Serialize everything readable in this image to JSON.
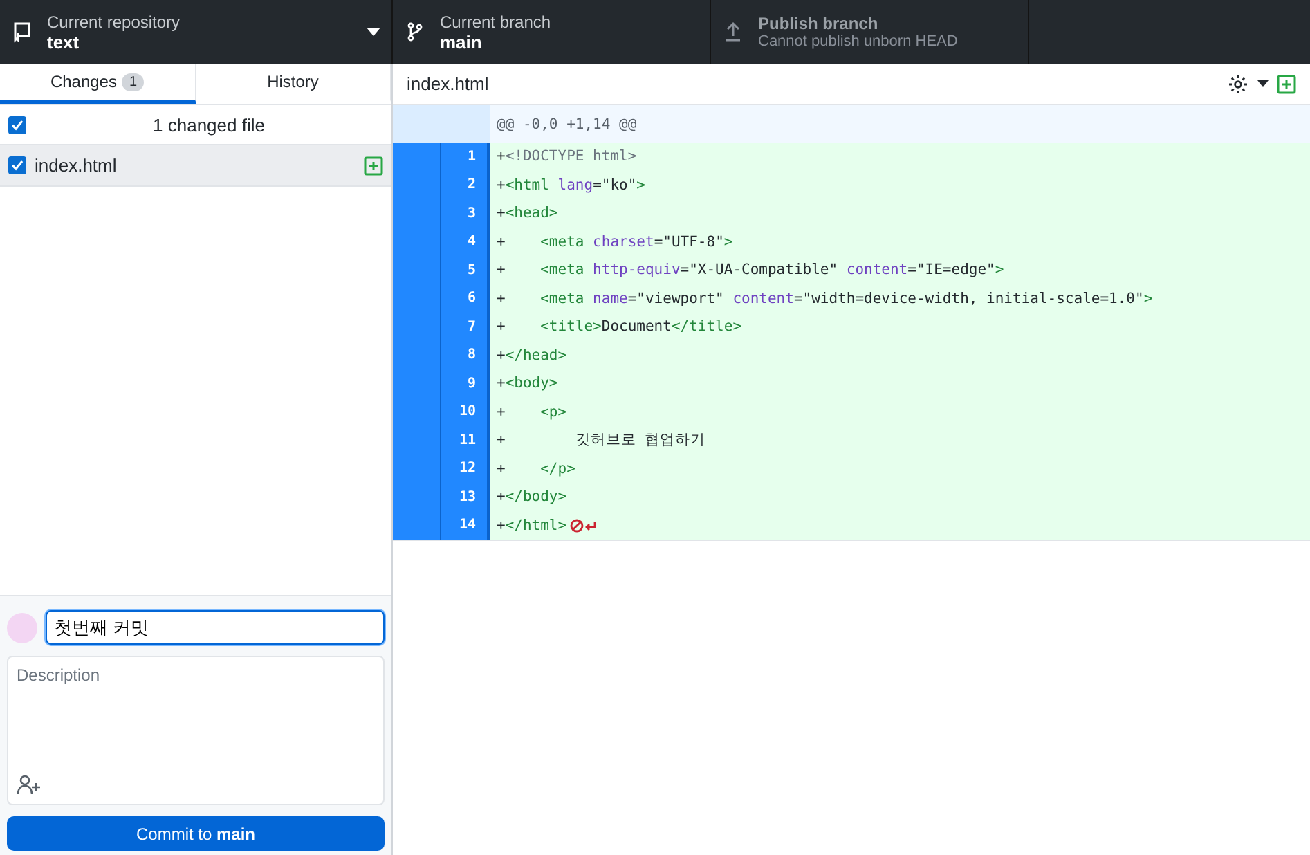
{
  "toolbar": [
    {
      "kind": "repository",
      "label": "Current repository",
      "value": "text",
      "disabled": false
    },
    {
      "kind": "branch",
      "label": "Current branch",
      "value": "main",
      "disabled": false
    },
    {
      "kind": "publish",
      "label": "Publish branch",
      "value": "Cannot publish unborn HEAD",
      "disabled": true
    }
  ],
  "tabs": [
    {
      "label": "Changes",
      "count": "1",
      "selected": true
    },
    {
      "label": "History",
      "selected": false
    }
  ],
  "changes_header": {
    "label": "1 changed file",
    "checked": true
  },
  "files": [
    {
      "name": "index.html",
      "checked": true,
      "selected": true,
      "kind": "added"
    }
  ],
  "diff": {
    "path": "index.html",
    "hunk": "@@ -0,0 +1,14 @@",
    "lines": [
      {
        "number": "1",
        "segments": [
          {
            "kind": "plain",
            "text": "+"
          },
          {
            "kind": "doctype",
            "text": "<!DOCTYPE html>"
          }
        ]
      },
      {
        "number": "2",
        "segments": [
          {
            "kind": "plain",
            "text": "+"
          },
          {
            "kind": "tag",
            "text": "<html "
          },
          {
            "kind": "attr",
            "text": "lang"
          },
          {
            "kind": "plain",
            "text": "=\"ko\""
          },
          {
            "kind": "tag",
            "text": ">"
          }
        ]
      },
      {
        "number": "3",
        "segments": [
          {
            "kind": "plain",
            "text": "+"
          },
          {
            "kind": "tag",
            "text": "<head>"
          }
        ]
      },
      {
        "number": "4",
        "segments": [
          {
            "kind": "plain",
            "text": "+    "
          },
          {
            "kind": "tag",
            "text": "<meta "
          },
          {
            "kind": "attr",
            "text": "charset"
          },
          {
            "kind": "plain",
            "text": "=\"UTF-8\""
          },
          {
            "kind": "tag",
            "text": ">"
          }
        ]
      },
      {
        "number": "5",
        "segments": [
          {
            "kind": "plain",
            "text": "+    "
          },
          {
            "kind": "tag",
            "text": "<meta "
          },
          {
            "kind": "attr",
            "text": "http-equiv"
          },
          {
            "kind": "plain",
            "text": "=\"X-UA-Compatible\" "
          },
          {
            "kind": "attr",
            "text": "content"
          },
          {
            "kind": "plain",
            "text": "=\"IE=edge\""
          },
          {
            "kind": "tag",
            "text": ">"
          }
        ]
      },
      {
        "number": "6",
        "segments": [
          {
            "kind": "plain",
            "text": "+    "
          },
          {
            "kind": "tag",
            "text": "<meta "
          },
          {
            "kind": "attr",
            "text": "name"
          },
          {
            "kind": "plain",
            "text": "=\"viewport\" "
          },
          {
            "kind": "attr",
            "text": "content"
          },
          {
            "kind": "plain",
            "text": "=\"width=device-width, initial-scale=1.0\""
          },
          {
            "kind": "tag",
            "text": ">"
          }
        ]
      },
      {
        "number": "7",
        "segments": [
          {
            "kind": "plain",
            "text": "+    "
          },
          {
            "kind": "tag",
            "text": "<title>"
          },
          {
            "kind": "plain",
            "text": "Document"
          },
          {
            "kind": "tag",
            "text": "</title>"
          }
        ]
      },
      {
        "number": "8",
        "segments": [
          {
            "kind": "plain",
            "text": "+"
          },
          {
            "kind": "tag",
            "text": "</head>"
          }
        ]
      },
      {
        "number": "9",
        "segments": [
          {
            "kind": "plain",
            "text": "+"
          },
          {
            "kind": "tag",
            "text": "<body>"
          }
        ]
      },
      {
        "number": "10",
        "segments": [
          {
            "kind": "plain",
            "text": "+    "
          },
          {
            "kind": "tag",
            "text": "<p>"
          }
        ]
      },
      {
        "number": "11",
        "segments": [
          {
            "kind": "plain",
            "text": "+        깃허브로 협업하기"
          }
        ]
      },
      {
        "number": "12",
        "segments": [
          {
            "kind": "plain",
            "text": "+    "
          },
          {
            "kind": "tag",
            "text": "</p>"
          }
        ]
      },
      {
        "number": "13",
        "segments": [
          {
            "kind": "plain",
            "text": "+"
          },
          {
            "kind": "tag",
            "text": "</body>"
          }
        ]
      },
      {
        "number": "14",
        "no_newline": true,
        "segments": [
          {
            "kind": "plain",
            "text": "+"
          },
          {
            "kind": "tag",
            "text": "</html>"
          }
        ]
      }
    ]
  },
  "commit": {
    "summary": "첫번째 커밋",
    "description_placeholder": "Description",
    "button": "Commit to **main**"
  }
}
